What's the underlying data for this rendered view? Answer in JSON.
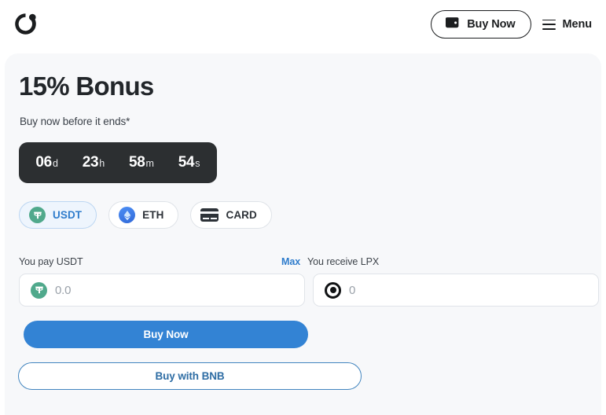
{
  "header": {
    "logo_icon": "lpx-logo-icon",
    "buy_now_label": "Buy Now",
    "wallet_icon": "wallet-icon",
    "menu_label": "Menu",
    "menu_icon": "hamburger-icon"
  },
  "promo": {
    "headline": "15% Bonus",
    "subline": "Buy now before it ends*"
  },
  "countdown": {
    "units": [
      {
        "value": "06",
        "suffix": "d"
      },
      {
        "value": "23",
        "suffix": "h"
      },
      {
        "value": "58",
        "suffix": "m"
      },
      {
        "value": "54",
        "suffix": "s"
      }
    ]
  },
  "payment_methods": [
    {
      "label": "USDT",
      "icon": "tether-icon",
      "selected": true
    },
    {
      "label": "ETH",
      "icon": "ethereum-icon",
      "selected": false
    },
    {
      "label": "CARD",
      "icon": "credit-card-icon",
      "selected": false
    }
  ],
  "swap": {
    "pay_label": "You pay USDT",
    "max_label": "Max",
    "receive_label": "You receive LPX",
    "pay_placeholder": "0.0",
    "pay_value": "",
    "receive_value": "0",
    "pay_icon": "tether-icon",
    "receive_icon": "lpx-logo-icon"
  },
  "actions": {
    "buy_now_label": "Buy Now",
    "buy_with_bnb_label": "Buy with BNB"
  },
  "colors": {
    "accent_blue": "#3383d4",
    "link_blue": "#2e7ccc",
    "dark": "#2c2f31",
    "card_bg": "#f7f8fa",
    "usdt_green": "#50a98c"
  }
}
